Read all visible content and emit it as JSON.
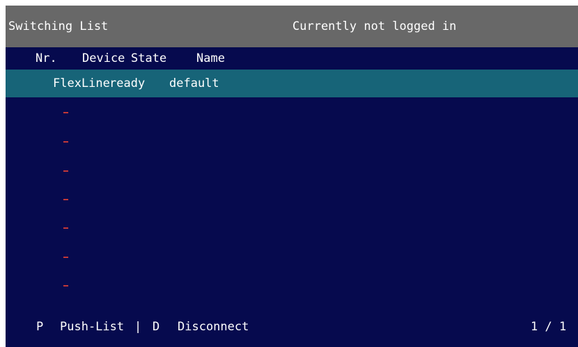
{
  "header": {
    "title": "Switching List",
    "status": "Currently not logged in"
  },
  "columns": {
    "nr": "Nr.",
    "device": "Device",
    "state": "State",
    "name": "Name"
  },
  "rows": [
    {
      "device": "FlexLine",
      "state": "ready",
      "name": "default",
      "selected": true
    },
    {
      "empty_marker": "-"
    },
    {
      "empty_marker": "-"
    },
    {
      "empty_marker": "-"
    },
    {
      "empty_marker": "-"
    },
    {
      "empty_marker": "-"
    },
    {
      "empty_marker": "-"
    },
    {
      "empty_marker": "-"
    }
  ],
  "footer": {
    "push_key": "P",
    "push_label": "Push-List",
    "separator": "|",
    "disconnect_key": "D",
    "disconnect_label": "Disconnect",
    "page": "1 / 1"
  },
  "colors": {
    "background": "#060a4e",
    "title_bar": "#686868",
    "selected_row": "#176478",
    "empty_marker": "#c23838",
    "text": "#ffffff"
  }
}
